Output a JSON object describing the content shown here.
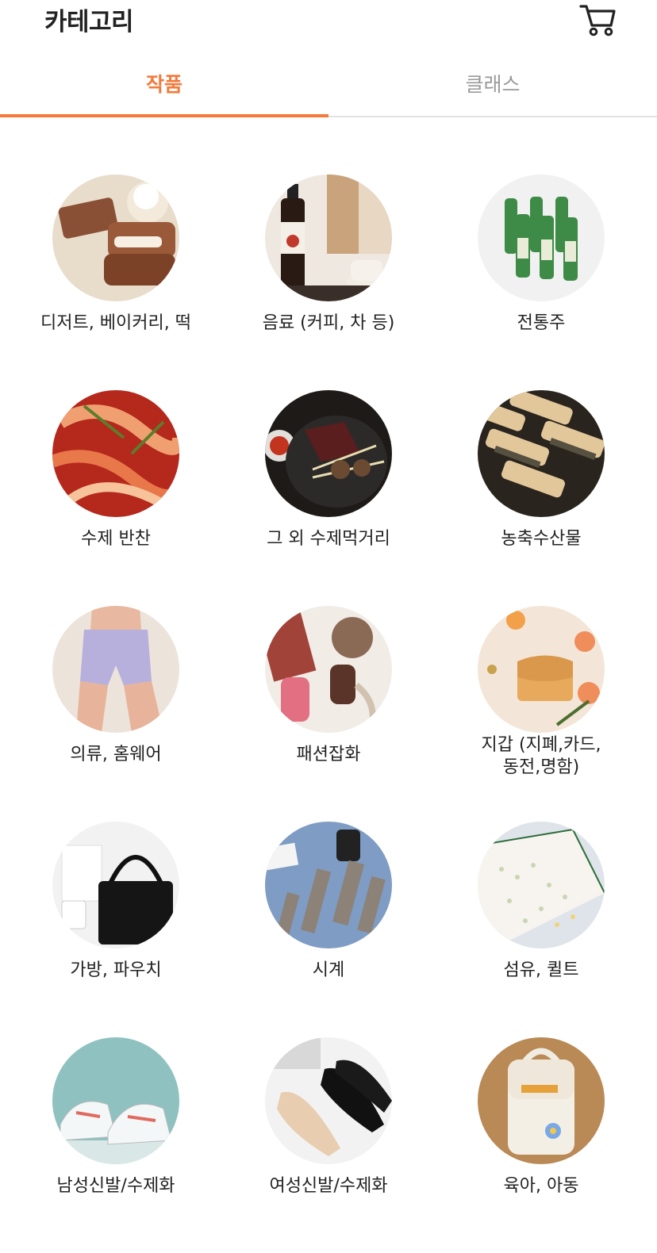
{
  "header": {
    "title": "카테고리",
    "cart_icon": "cart-icon"
  },
  "tabs": [
    {
      "label": "작품",
      "active": true
    },
    {
      "label": "클래스",
      "active": false
    }
  ],
  "colors": {
    "accent": "#f4793a",
    "inactive_tab": "#9a9a9a",
    "divider": "#e2e2e2"
  },
  "categories": [
    {
      "label": "디저트, 베이커리, 떡",
      "image": "dessert-image"
    },
    {
      "label": "음료 (커피, 차 등)",
      "image": "beverage-image"
    },
    {
      "label": "전통주",
      "image": "traditional-liquor-image"
    },
    {
      "label": "수제 반찬",
      "image": "side-dish-image"
    },
    {
      "label": "그 외 수제먹거리",
      "image": "other-food-image"
    },
    {
      "label": "농축수산물",
      "image": "farm-fishery-image"
    },
    {
      "label": "의류, 홈웨어",
      "image": "clothing-image"
    },
    {
      "label": "패션잡화",
      "image": "fashion-accessory-image"
    },
    {
      "label": "지갑 (지폐,카드,\n동전,명함)",
      "image": "wallet-image"
    },
    {
      "label": "가방, 파우치",
      "image": "bag-image"
    },
    {
      "label": "시계",
      "image": "watch-image"
    },
    {
      "label": "섬유, 퀼트",
      "image": "textile-image"
    },
    {
      "label": "남성신발/수제화",
      "image": "mens-shoes-image"
    },
    {
      "label": "여성신발/수제화",
      "image": "womens-shoes-image"
    },
    {
      "label": "육아, 아동",
      "image": "kids-image"
    }
  ]
}
